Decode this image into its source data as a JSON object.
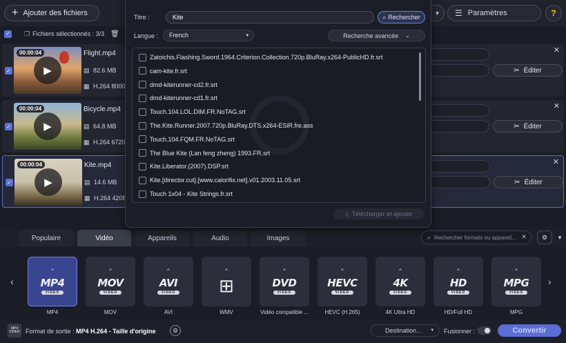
{
  "toolbar": {
    "add_files_label": "Ajouter des fichiers",
    "settings_label": "Paramètres",
    "help_label": "?"
  },
  "selection": {
    "label": "Fichiers sélectionnés : 3/3"
  },
  "files": [
    {
      "name": "Flight.mp4",
      "duration": "00:00:04",
      "size": "82.6 MB",
      "codec": "H.264 8000"
    },
    {
      "name": "Bicycle.mp4",
      "duration": "00:00:04",
      "size": "64.8 MB",
      "codec": "H.264 6720"
    },
    {
      "name": "Kite.mp4",
      "duration": "00:00:04",
      "size": "14.6 MB",
      "codec": "H.264 4208"
    }
  ],
  "edit_label": "Éditer",
  "search_popup": {
    "title_label": "Titre :",
    "title_value": "Kite",
    "search_button": "Rechercher",
    "language_label": "Langue :",
    "language_value": "French",
    "advanced_button": "Recherche avancée",
    "results": [
      "Zatoichis.Flashing.Sword.1964.Criterion.Collection.720p.BluRay.x264-PublicHD.fr.srt",
      "cam-kite.fr.srt",
      "dmd-kiterunner-cd2.fr.srt",
      "dmd-kiterunner-cd1.fr.srt",
      "Touch.104.LOL.DIM.FR.NoTAG.srt",
      "The.Kite.Runner.2007.720p.BluRay.DTS.x264-ESiR.fre.ass",
      "Touch.104.FQM.FR.NoTAG.srt",
      "The Blue Kite (Lan feng zheng) 1993.FR.srt",
      "Kite.Liberator.(2007).DSP.srt",
      "Kite.[director.cut].[www.calorifix.net].v01.2003.11.05.srt",
      "Touch 1x04 - Kite Strings.fr.srt"
    ],
    "download_button": "Télécharger et ajouter"
  },
  "format_tabs": [
    "Populaire",
    "Vidéo",
    "Appareils",
    "Audio",
    "Images"
  ],
  "active_tab": "Vidéo",
  "format_search_placeholder": "Rechercher formats ou appareil...",
  "formats": [
    {
      "big": "MP4",
      "sub": "VIDEO",
      "label": "MP4"
    },
    {
      "big": "MOV",
      "sub": "VIDEO",
      "label": "MOV"
    },
    {
      "big": "AVI",
      "sub": "VIDEO",
      "label": "AVI"
    },
    {
      "big": "",
      "sub": "",
      "label": "WMV"
    },
    {
      "big": "DVD",
      "sub": "VIDEO",
      "label": "Vidéo compatible ..."
    },
    {
      "big": "HEVC",
      "sub": "VIDEO",
      "label": "HEVC (H.265)"
    },
    {
      "big": "4K",
      "sub": "VIDEO",
      "label": "4K Ultra HD"
    },
    {
      "big": "HD",
      "sub": "VIDEO",
      "label": "HD/Full HD"
    },
    {
      "big": "MPG",
      "sub": "VIDEO",
      "label": "MPG"
    }
  ],
  "output": {
    "icon_text": "MP4 VIDEO",
    "label": "Format de sortie :",
    "value": "MP4 H.264 - Taille d'origine",
    "destination": "Destination...",
    "merge_label": "Fusionner :",
    "convert": "Convertir"
  },
  "colors": {
    "accent": "#5b6ed6",
    "background": "#1b1d26",
    "help": "#f5c518"
  }
}
